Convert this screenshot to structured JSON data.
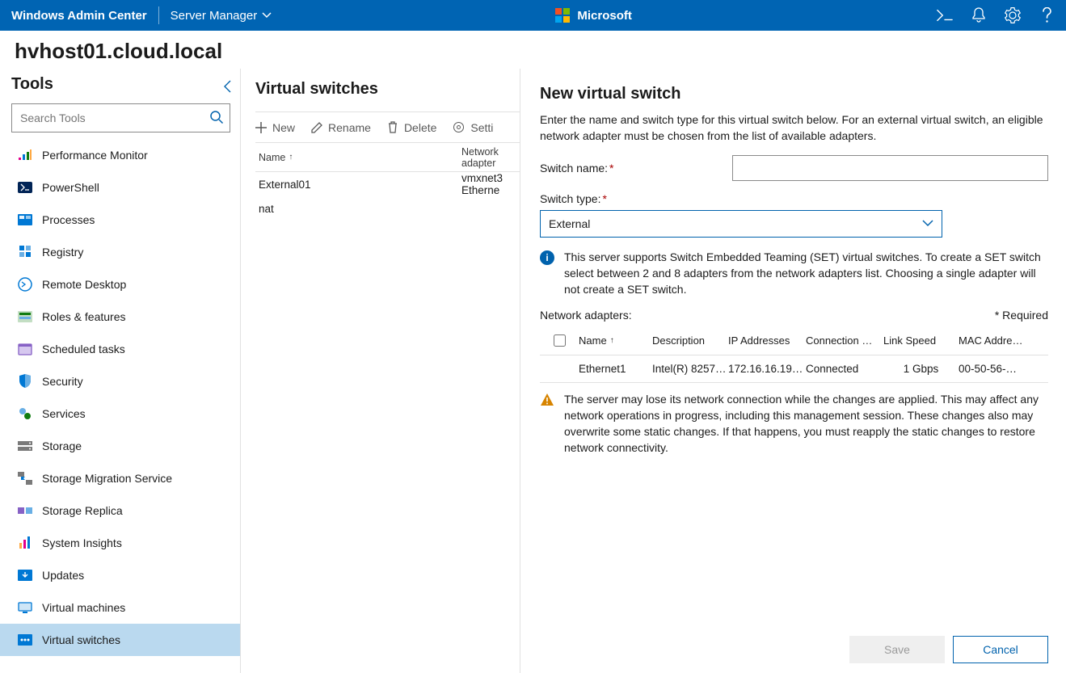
{
  "header": {
    "brand": "Windows Admin Center",
    "app": "Server Manager",
    "ms": "Microsoft"
  },
  "page": {
    "server": "hvhost01.cloud.local",
    "tools_label": "Tools",
    "search_placeholder": "Search Tools"
  },
  "sidebar": {
    "items": [
      {
        "label": "Performance Monitor"
      },
      {
        "label": "PowerShell"
      },
      {
        "label": "Processes"
      },
      {
        "label": "Registry"
      },
      {
        "label": "Remote Desktop"
      },
      {
        "label": "Roles & features"
      },
      {
        "label": "Scheduled tasks"
      },
      {
        "label": "Security"
      },
      {
        "label": "Services"
      },
      {
        "label": "Storage"
      },
      {
        "label": "Storage Migration Service"
      },
      {
        "label": "Storage Replica"
      },
      {
        "label": "System Insights"
      },
      {
        "label": "Updates"
      },
      {
        "label": "Virtual machines"
      },
      {
        "label": "Virtual switches"
      }
    ]
  },
  "main": {
    "title": "Virtual switches",
    "commands": {
      "new": "New",
      "rename": "Rename",
      "delete": "Delete",
      "settings": "Setti"
    },
    "columns": {
      "name": "Name",
      "network": "Network adapter"
    },
    "rows": [
      {
        "name": "External01",
        "net": "vmxnet3 Etherne"
      },
      {
        "name": "nat",
        "net": ""
      }
    ]
  },
  "panel": {
    "title": "New virtual switch",
    "intro": "Enter the name and switch type for this virtual switch below. For an external virtual switch, an eligible network adapter must be chosen from the list of available adapters.",
    "name_lbl": "Switch name:",
    "name_val": "",
    "type_lbl": "Switch type:",
    "type_val": "External",
    "set_info": "This server supports Switch Embedded Teaming (SET) virtual switches. To create a SET switch select between 2 and 8 adapters from the network adapters list. Choosing a single adapter will not create a SET switch.",
    "adapters_lbl": "Network adapters:",
    "required_lbl": "* Required",
    "acols": {
      "name": "Name",
      "desc": "Description",
      "ip": "IP Addresses",
      "conn": "Connection …",
      "speed": "Link Speed",
      "mac": "MAC Addre…"
    },
    "arows": [
      {
        "name": "Ethernet1",
        "desc": "Intel(R) 8257…",
        "ip": "172.16.16.19…",
        "conn": "Connected",
        "speed": "1 Gbps",
        "mac": "00-50-56-…"
      }
    ],
    "warn": "The server may lose its network connection while the changes are applied. This may affect any network operations in progress, including this management session. These changes also may overwrite some static changes. If that happens, you must reapply the static changes to restore network connectivity.",
    "save": "Save",
    "cancel": "Cancel"
  }
}
